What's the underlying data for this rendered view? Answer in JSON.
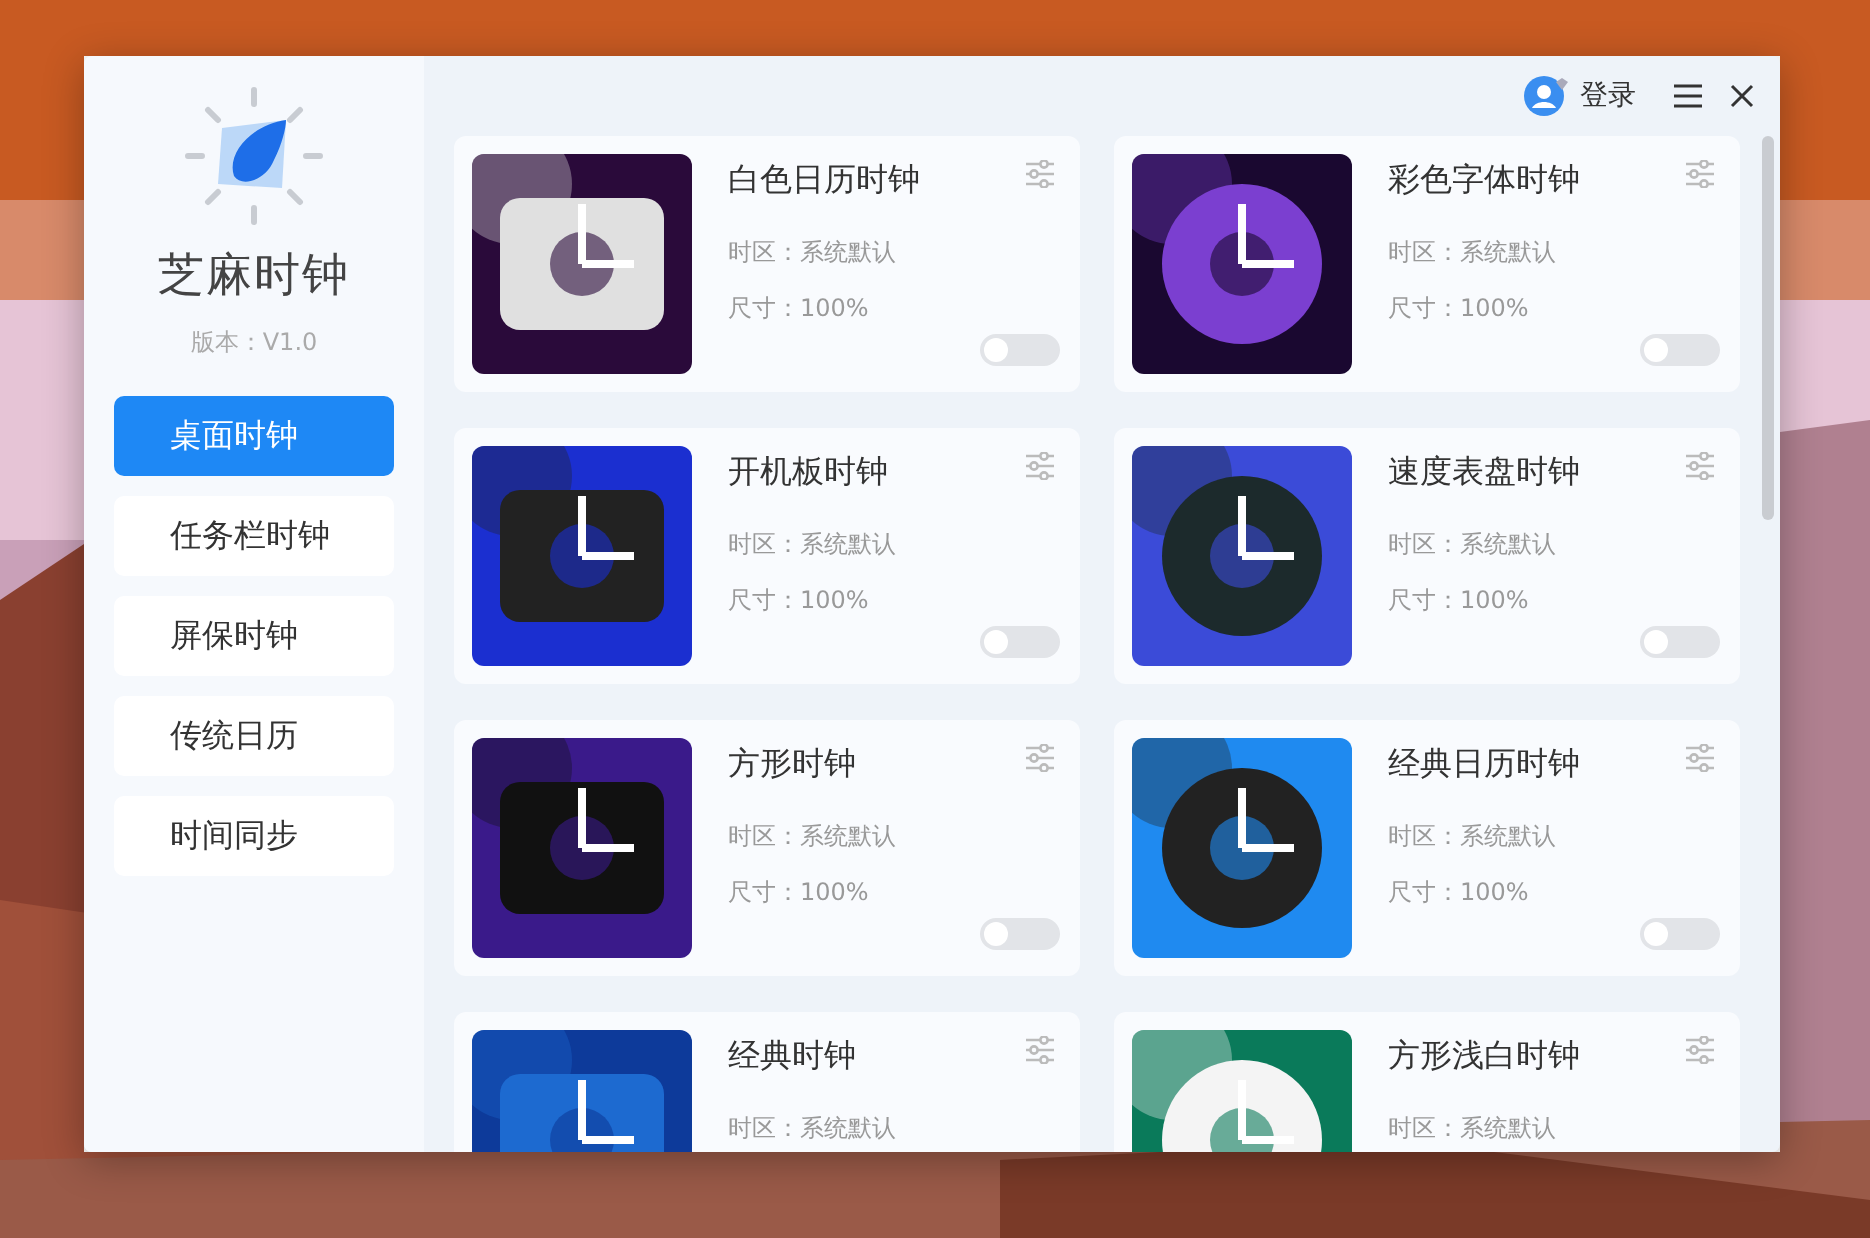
{
  "app": {
    "name": "芝麻时钟",
    "version": "版本：V1.0"
  },
  "sidebar": {
    "items": [
      {
        "label": "桌面时钟",
        "selected": true
      },
      {
        "label": "任务栏时钟",
        "selected": false
      },
      {
        "label": "屏保时钟",
        "selected": false
      },
      {
        "label": "传统日历",
        "selected": false
      },
      {
        "label": "时间同步",
        "selected": false
      }
    ]
  },
  "header": {
    "login": "登录"
  },
  "cards": [
    {
      "name": "白色日历时钟",
      "timezone": "时区：系统默认",
      "size": "尺寸：100%",
      "on": false
    },
    {
      "name": "彩色字体时钟",
      "timezone": "时区：系统默认",
      "size": "尺寸：100%",
      "on": false
    },
    {
      "name": "开机板时钟",
      "timezone": "时区：系统默认",
      "size": "尺寸：100%",
      "on": false
    },
    {
      "name": "速度表盘时钟",
      "timezone": "时区：系统默认",
      "size": "尺寸：100%",
      "on": false
    },
    {
      "name": "方形时钟",
      "timezone": "时区：系统默认",
      "size": "尺寸：100%",
      "on": false
    },
    {
      "name": "经典日历时钟",
      "timezone": "时区：系统默认",
      "size": "尺寸：100%",
      "on": false
    },
    {
      "name": "经典时钟",
      "timezone": "时区：系统默认"
    },
    {
      "name": "方形浅白时钟",
      "timezone": "时区：系统默认"
    }
  ]
}
